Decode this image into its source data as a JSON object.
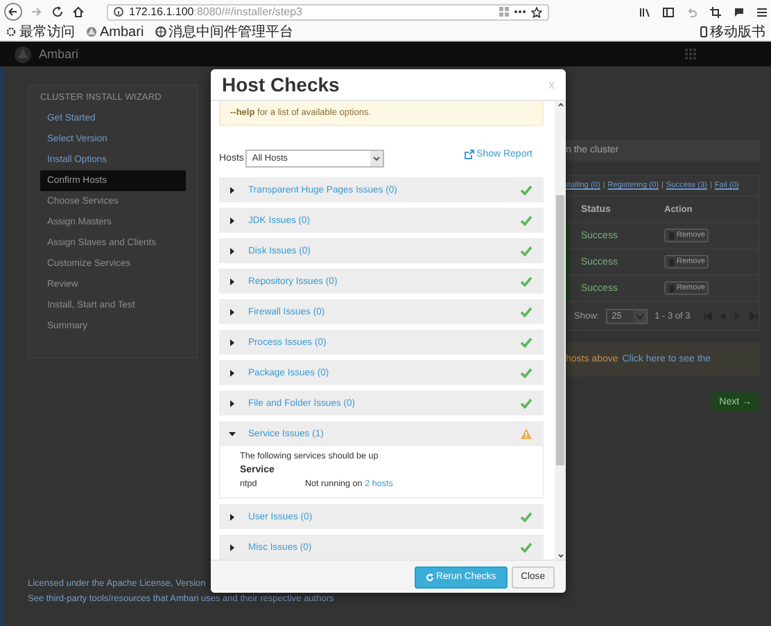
{
  "browser": {
    "url_host": "172.16.1.100",
    "url_rest": ":8080/#/installer/step3",
    "bookmarks": [
      {
        "label": "最常访问"
      },
      {
        "label": "Ambari"
      },
      {
        "label": "消息中间件管理平台"
      }
    ],
    "mobile_bookmarks": "移动版书"
  },
  "app": {
    "title": "Ambari"
  },
  "sidebar": {
    "heading": "CLUSTER INSTALL WIZARD",
    "items": [
      {
        "label": "Get Started",
        "completed": true,
        "selected": false
      },
      {
        "label": "Select Version",
        "completed": true,
        "selected": false
      },
      {
        "label": "Install Options",
        "completed": true,
        "selected": false
      },
      {
        "label": "Confirm Hosts",
        "completed": false,
        "selected": true
      },
      {
        "label": "Choose Services",
        "completed": false,
        "selected": false
      },
      {
        "label": "Assign Masters",
        "completed": false,
        "selected": false
      },
      {
        "label": "Assign Slaves and Clients",
        "completed": false,
        "selected": false
      },
      {
        "label": "Customize Services",
        "completed": false,
        "selected": false
      },
      {
        "label": "Review",
        "completed": false,
        "selected": false
      },
      {
        "label": "Install, Start and Test",
        "completed": false,
        "selected": false
      },
      {
        "label": "Summary",
        "completed": false,
        "selected": false
      }
    ]
  },
  "hosts_panel": {
    "notice": "n the cluster",
    "filters": [
      "stalling (0)",
      "Registering (0)",
      "Success (3)",
      "Fail (0)"
    ],
    "separator": "|",
    "columns": [
      "Status",
      "Action"
    ],
    "rows": [
      {
        "status": "Success",
        "action": "Remove"
      },
      {
        "status": "Success",
        "action": "Remove"
      },
      {
        "status": "Success",
        "action": "Remove"
      }
    ],
    "show_label": "Show:",
    "page_size": "25",
    "range": "1 - 3 of 3",
    "warning_text": "hosts above",
    "warning_link": "Click here to see the",
    "next_button": "Next →"
  },
  "footer": {
    "lines": [
      "Licensed under the Apache License, Version",
      "See third-party tools/resources that Ambari uses and their respective authors"
    ]
  },
  "modal": {
    "title": "Host Checks",
    "close": "x",
    "notice": "**--help** for a list of available options.",
    "hosts_label": "Hosts",
    "hosts_value": "All Hosts",
    "report_link": "Show Report",
    "checks": [
      {
        "title": "Transparent Huge Pages Issues (0)",
        "kind": "ok",
        "expanded": false
      },
      {
        "title": "JDK Issues (0)",
        "kind": "ok",
        "expanded": false
      },
      {
        "title": "Disk Issues (0)",
        "kind": "ok",
        "expanded": false
      },
      {
        "title": "Repository Issues (0)",
        "kind": "ok",
        "expanded": false
      },
      {
        "title": "Firewall Issues (0)",
        "kind": "ok",
        "expanded": false
      },
      {
        "title": "Process Issues (0)",
        "kind": "ok",
        "expanded": false
      },
      {
        "title": "Package Issues (0)",
        "kind": "ok",
        "expanded": false
      },
      {
        "title": "File and Folder Issues (0)",
        "kind": "ok",
        "expanded": false
      },
      {
        "title": "Service Issues (1)",
        "kind": "warning",
        "expanded": true,
        "details": {
          "intro": "The following services should be up",
          "heading": "Service",
          "rows": [
            {
              "name": "ntpd",
              "text": "Not running on",
              "link": "2 hosts"
            }
          ]
        }
      },
      {
        "title": "User Issues (0)",
        "kind": "ok",
        "expanded": false
      },
      {
        "title": "Misc Issues (0)",
        "kind": "ok",
        "expanded": false
      }
    ],
    "buttons": [
      {
        "label": "Rerun Checks",
        "kind": "primary"
      },
      {
        "label": "Close",
        "kind": "default"
      }
    ]
  }
}
